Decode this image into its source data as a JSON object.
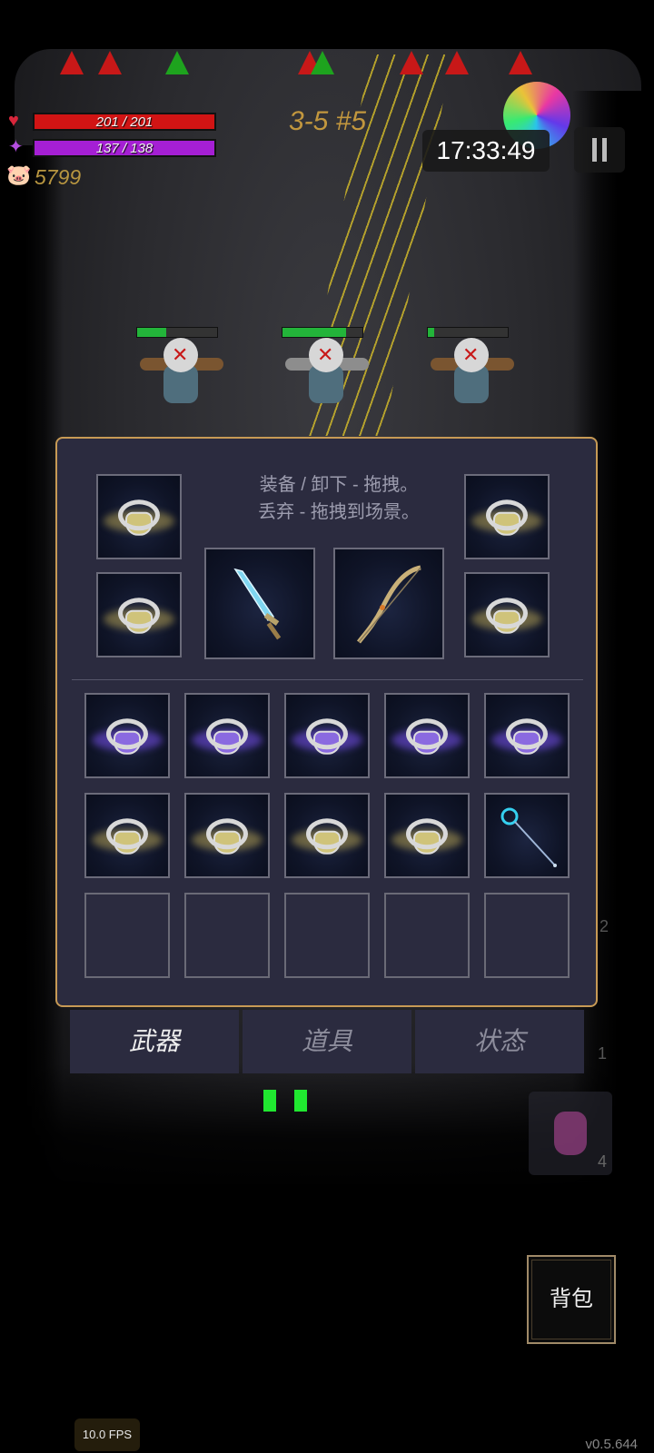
{
  "hud": {
    "hp_text": "201 / 201",
    "hp_fill": 1.0,
    "mp_text": "137 / 138",
    "mp_fill": 0.993,
    "gold": "5799",
    "stage": "3-5 #5",
    "clock": "17:33:49"
  },
  "inventory": {
    "hint_line1": "装备 / 卸下 - 拖拽。",
    "hint_line2": "丢弃 - 拖拽到场景。",
    "equipped": [
      {
        "slot": "ring-top-left",
        "item": "gold-ring"
      },
      {
        "slot": "ring-bottom-left",
        "item": "gold-ring"
      },
      {
        "slot": "weapon-1",
        "item": "sword"
      },
      {
        "slot": "weapon-2",
        "item": "bow"
      },
      {
        "slot": "ring-top-right",
        "item": "gold-ring"
      },
      {
        "slot": "ring-bottom-right",
        "item": "gold-ring"
      }
    ],
    "bag": [
      "purple-ring",
      "purple-ring",
      "purple-ring",
      "purple-ring",
      "purple-ring",
      "gold-ring",
      "gold-ring",
      "gold-ring",
      "gold-ring",
      "wand",
      "empty",
      "empty",
      "empty",
      "empty",
      "empty"
    ]
  },
  "tabs": [
    {
      "label": "武器",
      "active": true
    },
    {
      "label": "道具",
      "active": false
    },
    {
      "label": "状态",
      "active": false
    }
  ],
  "enemies": [
    {
      "hp": 0.36
    },
    {
      "hp": 0.8
    },
    {
      "hp": 0.08
    }
  ],
  "side_counts": [
    "2",
    "1"
  ],
  "potion_count": "4",
  "bag_button": "背包",
  "fps": "10.0 FPS",
  "version": "v0.5.644",
  "colors": {
    "panel_border": "#c79a55",
    "panel_bg": "#2b2b3f",
    "hp": "#d11414",
    "mp": "#a51fd4",
    "gold_text": "#b89640"
  }
}
